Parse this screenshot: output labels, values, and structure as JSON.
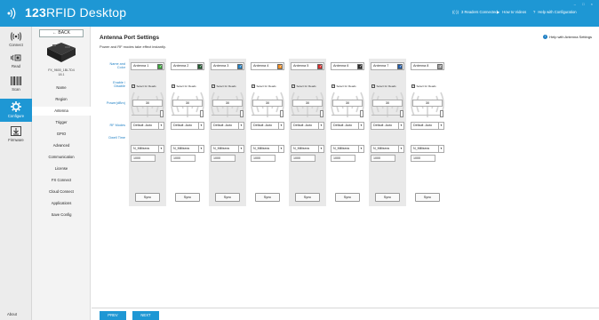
{
  "app": {
    "title_bold": "123",
    "title_rest": "RFID Desktop",
    "readers_connected": "3 Readers Connected",
    "how_to_videos": "How to Videos",
    "help_config": "Help with Configuration"
  },
  "rail": [
    {
      "label": "Connect",
      "icon": "antenna-icon",
      "active": false
    },
    {
      "label": "Read",
      "icon": "tag-read-icon",
      "active": false
    },
    {
      "label": "Scan",
      "icon": "barcode-icon",
      "active": false
    },
    {
      "label": "Configure",
      "icon": "gear-icon",
      "active": true
    },
    {
      "label": "Firmware",
      "icon": "download-icon",
      "active": false
    }
  ],
  "rail_about": "About",
  "sidebar": {
    "back": "← BACK",
    "device_id_1": "FX_9600_1BL7D4",
    "device_id_2": "18.1",
    "items": [
      "Name",
      "Region",
      "Antenna",
      "Trigger",
      "GPIO",
      "Advanced",
      "Communication",
      "License",
      "FX Connect",
      "Cloud Connect",
      "Applications",
      "Save Config"
    ],
    "active_index": 2
  },
  "main": {
    "title": "Antenna Port Settings",
    "subtitle": "Power and RF modes take effect instantly.",
    "help": "Help with Antenna Settings",
    "labels": {
      "name_color_1": "Name and",
      "name_color_2": "Color",
      "enable_1": "Enable /",
      "enable_2": "Disable",
      "power": "Power(dBm)",
      "rf_modes": "RF Modes",
      "dwell": "Dwell Time"
    },
    "enable_text": "Select for Reads",
    "sync_label": "Sync",
    "antennas": [
      {
        "name": "Antenna 1",
        "color": "#3aa83a",
        "power": "30",
        "rf_mode": "Default -Auto",
        "dwell_unit": "N_Millisecs",
        "dwell": "1000",
        "slider": 1.0
      },
      {
        "name": "Antenna 2",
        "color": "#1e5a2e",
        "power": "30",
        "rf_mode": "Default -Auto",
        "dwell_unit": "N_Millisecs",
        "dwell": "1000",
        "slider": 1.0
      },
      {
        "name": "Antenna 3",
        "color": "#1e7fc4",
        "power": "30",
        "rf_mode": "Default -Auto",
        "dwell_unit": "N_Millisecs",
        "dwell": "1000",
        "slider": 1.0
      },
      {
        "name": "Antenna 4",
        "color": "#f08a1c",
        "power": "30",
        "rf_mode": "Default -Auto",
        "dwell_unit": "N_Millisecs",
        "dwell": "1000",
        "slider": 1.0
      },
      {
        "name": "Antenna 5",
        "color": "#d42a2a",
        "power": "30",
        "rf_mode": "Default -Auto",
        "dwell_unit": "N_Millisecs",
        "dwell": "1000",
        "slider": 1.0
      },
      {
        "name": "Antenna 6",
        "color": "#2a2a2a",
        "power": "30",
        "rf_mode": "Default -Auto",
        "dwell_unit": "N_Millisecs",
        "dwell": "1000",
        "slider": 1.0
      },
      {
        "name": "Antenna 7",
        "color": "#1e5aa8",
        "power": "30",
        "rf_mode": "Default -Auto",
        "dwell_unit": "N_Millisecs",
        "dwell": "1000",
        "slider": 1.0
      },
      {
        "name": "Antenna 8",
        "color": "#9a9a9a",
        "power": "30",
        "rf_mode": "Default -Auto",
        "dwell_unit": "N_Millisecs",
        "dwell": "1000",
        "slider": 1.0
      }
    ]
  },
  "footer": {
    "prev": "PREV",
    "next": "NEXT"
  }
}
